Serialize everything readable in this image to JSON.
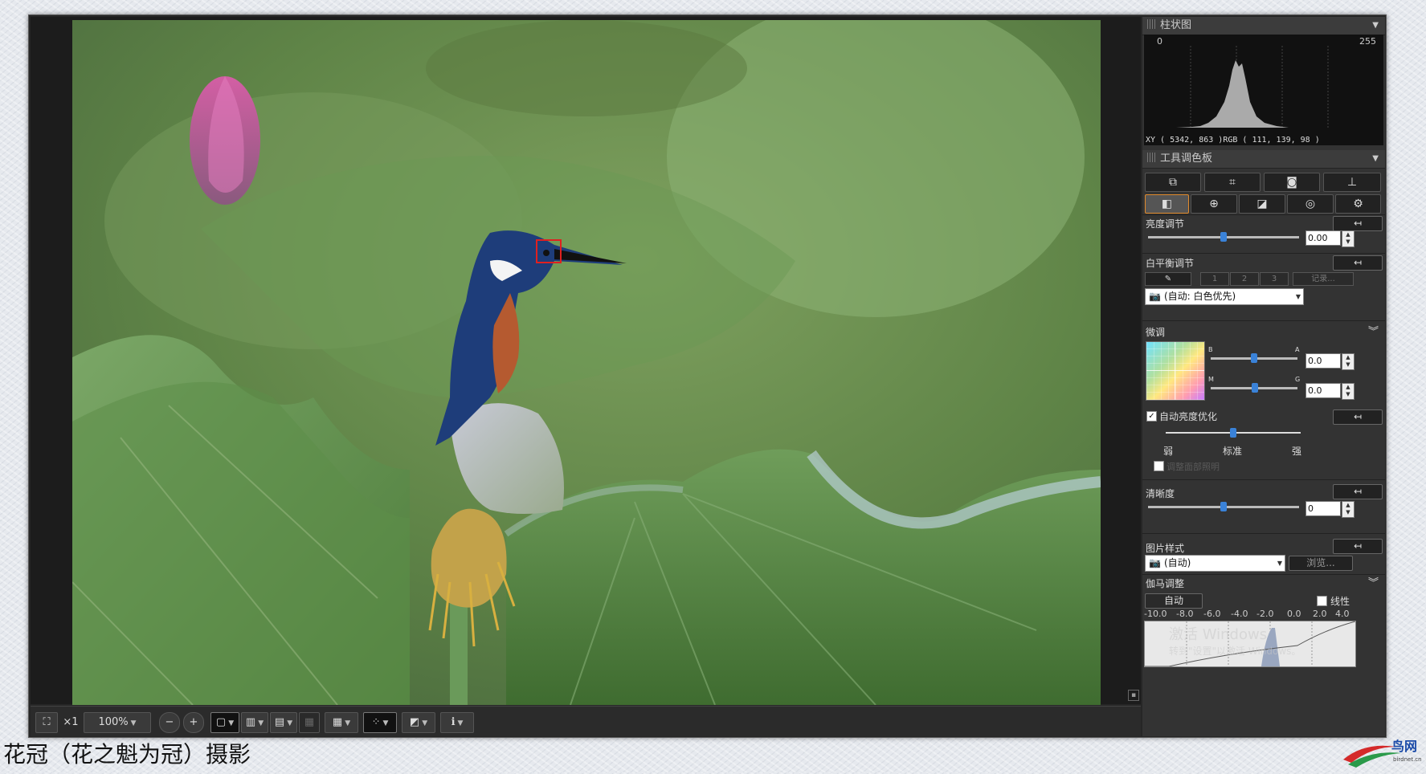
{
  "histogram": {
    "title": "柱状图",
    "min_label": "0",
    "max_label": "255",
    "readout": "XY ( 5342,   863 )RGB ( 111,  139,   98 )"
  },
  "palette": {
    "title": "工具调色板"
  },
  "brightness": {
    "label": "亮度调节",
    "value": "0.00",
    "level": 0.5
  },
  "white_balance": {
    "label": "白平衡调节",
    "presets": [
      "1",
      "2",
      "3"
    ],
    "record_label": "记录...",
    "mode": "(自动: 白色优先)"
  },
  "fine_tune": {
    "label": "微调",
    "axis_b": "B",
    "axis_a": "A",
    "axis_m": "M",
    "axis_g": "G",
    "ba_value": "0.0",
    "mg_value": "0.0"
  },
  "auto_light": {
    "label": "自动亮度优化",
    "checked": true,
    "weak": "弱",
    "standard": "标准",
    "strong": "强",
    "sub_option": "调整面部照明"
  },
  "clarity": {
    "label": "清晰度",
    "value": "0"
  },
  "picture_style": {
    "label": "图片样式",
    "value": "(自动)",
    "browse": "浏览..."
  },
  "gamma": {
    "label": "伽马调整",
    "auto_label": "自动",
    "linear_label": "线性",
    "ticks": [
      "-10.0",
      "-8.0",
      "-6.0",
      "-4.0",
      "-2.0",
      "0.0",
      "2.0",
      "4.0"
    ]
  },
  "toolbar": {
    "scale_label": "×1",
    "zoom_value": "100%"
  },
  "watermark": {
    "line1": "激活 Windows",
    "line2": "转到\"设置\"以激活 Windows。"
  },
  "caption": "花冠（花之魁为冠）摄影",
  "logo_text": "鸟网",
  "logo_sub": "birdnet.cn",
  "colors": {
    "accent_blue": "#3a82d8",
    "tab_orange": "#e08a2c",
    "panel_bg": "#333333"
  }
}
